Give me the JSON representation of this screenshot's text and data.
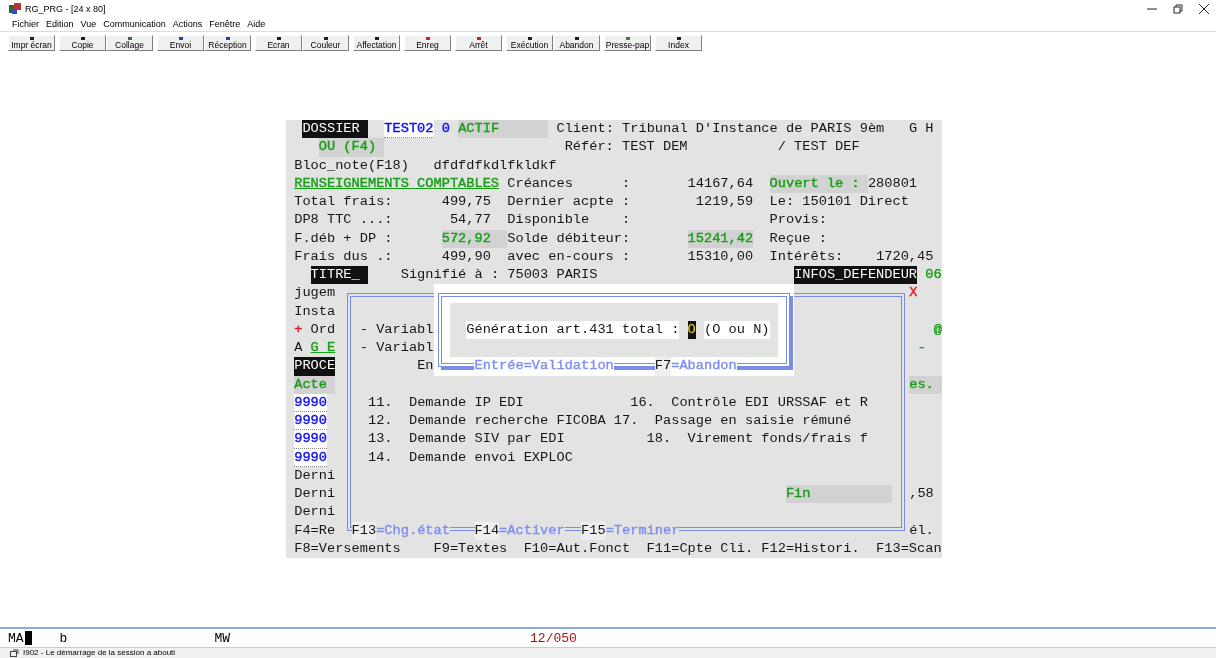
{
  "window": {
    "title": "RG_PRG - [24 x 80]"
  },
  "menu": [
    "Fichier",
    "Edition",
    "Vue",
    "Communication",
    "Actions",
    "Fenêtre",
    "Aide"
  ],
  "toolbar": [
    [
      {
        "label": "Impr écran",
        "color": "#202020"
      }
    ],
    [
      {
        "label": "Copie",
        "color": "#202020"
      },
      {
        "label": "Collage",
        "color": "#2a7a2a"
      }
    ],
    [
      {
        "label": "Envoi",
        "color": "#2040c0"
      },
      {
        "label": "Réception",
        "color": "#2040c0"
      }
    ],
    [
      {
        "label": "Ecran",
        "color": "#202020"
      },
      {
        "label": "Couleur",
        "color": "#202020"
      }
    ],
    [
      {
        "label": "Affectation",
        "color": "#202020"
      }
    ],
    [
      {
        "label": "Enreg",
        "color": "#d02020"
      }
    ],
    [
      {
        "label": "Arrêt",
        "color": "#d02020"
      }
    ],
    [
      {
        "label": "Exécution",
        "color": "#202020"
      },
      {
        "label": "Abandon",
        "color": "#202020"
      }
    ],
    [
      {
        "label": "Presse-pap",
        "color": "#2a8a2a"
      }
    ],
    [
      {
        "label": "Index",
        "color": "#202020"
      }
    ]
  ],
  "screen": {
    "lines": [
      {
        "segments": [
          {
            "text": " DOSSIER ",
            "kind": "inverse"
          },
          {
            "text": "  TEST02",
            "kind": "input",
            "color": "#1010f0"
          },
          {
            "text": " 0",
            "kind": "text",
            "color": "#1010f0"
          },
          {
            "text": " ACTIF      ",
            "kind": "field",
            "color": "#18a018"
          },
          {
            "text": " Client: Tribunal D'Instance de PARIS 9èm",
            "kind": "text"
          },
          {
            "text": "   G H",
            "kind": "text"
          }
        ]
      },
      {
        "segments": [
          {
            "text": "   OU (F4) ",
            "kind": "field",
            "color": "#18a018"
          },
          {
            "text": "                      Référ: TEST DEM",
            "kind": "text"
          },
          {
            "text": "           / TEST DEF",
            "kind": "text"
          }
        ]
      },
      {
        "segments": [
          {
            "text": "Bloc_note(F18)",
            "kind": "text"
          },
          {
            "text": "   dfdfdfkdlfkldkf",
            "kind": "text"
          }
        ]
      },
      {
        "segments": [
          {
            "text": "RENSEIGNEMENTS COMPTABLES",
            "kind": "text",
            "color": "#18a018",
            "underline": true
          },
          {
            "text": " Créances",
            "kind": "text"
          },
          {
            "text": "      :",
            "kind": "text"
          },
          {
            "text": "       14167,64",
            "kind": "text"
          },
          {
            "text": "  Ouvert le : ",
            "kind": "field",
            "color": "#18a018"
          },
          {
            "text": "280801",
            "kind": "text"
          }
        ]
      },
      {
        "segments": [
          {
            "text": "Total frais:",
            "kind": "text"
          },
          {
            "text": "      499,75",
            "kind": "text"
          },
          {
            "text": "  Dernier acpte :",
            "kind": "text"
          },
          {
            "text": "        1219,59",
            "kind": "text"
          },
          {
            "text": "  Le: 150101 Direct",
            "kind": "text"
          }
        ]
      },
      {
        "segments": [
          {
            "text": "DP8 TTC ...:",
            "kind": "text"
          },
          {
            "text": "       54,77",
            "kind": "text"
          },
          {
            "text": "  Disponible",
            "kind": "text"
          },
          {
            "text": "    :",
            "kind": "text"
          },
          {
            "text": "                 Provis:",
            "kind": "text"
          }
        ]
      },
      {
        "segments": [
          {
            "text": "F.déb + DP :",
            "kind": "text"
          },
          {
            "text": "      572,92  ",
            "kind": "field",
            "color": "#18a018"
          },
          {
            "text": "Solde débiteur:",
            "kind": "text"
          },
          {
            "text": "       15241,42",
            "kind": "field",
            "color": "#18a018"
          },
          {
            "text": "  Reçue :",
            "kind": "text"
          }
        ]
      },
      {
        "segments": [
          {
            "text": "Frais dus .:",
            "kind": "text"
          },
          {
            "text": "      499,90",
            "kind": "text"
          },
          {
            "text": "  avec en-cours :",
            "kind": "text"
          },
          {
            "text": "       15310,00",
            "kind": "text"
          },
          {
            "text": "  Intérêts:",
            "kind": "text"
          },
          {
            "text": "    1720,45",
            "kind": "text"
          }
        ]
      },
      {
        "segments": [
          {
            "text": "  TITRE_ ",
            "kind": "inverse"
          },
          {
            "text": "    Signifié à :",
            "kind": "text"
          },
          {
            "text": " 75003 PARIS",
            "kind": "text"
          },
          {
            "text": "                        INFOS_DEFENDEUR",
            "kind": "inverse"
          },
          {
            "text": " 06",
            "kind": "text",
            "color": "#18a018"
          }
        ]
      },
      {
        "segments": [
          {
            "text": "jugem",
            "kind": "text"
          }
        ],
        "right": [
          {
            "text": "X",
            "kind": "text",
            "color": "#e02020"
          }
        ]
      },
      {
        "segments": [
          {
            "text": "Insta",
            "kind": "text"
          }
        ]
      },
      {
        "segments": [
          {
            "text": "+",
            "kind": "text",
            "color": "#e02020"
          },
          {
            "text": " Ord",
            "kind": "text"
          }
        ],
        "right": [
          {
            "text": "   @",
            "kind": "text",
            "color": "#18a018"
          }
        ]
      },
      {
        "segments": [
          {
            "text": "A",
            "kind": "text"
          },
          {
            "text": " G E",
            "kind": "text",
            "color": "#18a018",
            "underline": true
          }
        ],
        "right": [
          {
            "text": " -",
            "kind": "text",
            "color": "#18a018"
          }
        ]
      },
      {
        "segments": [
          {
            "text": "PROCE",
            "kind": "inverse"
          }
        ]
      },
      {
        "segments": [
          {
            "text": "Acte ",
            "kind": "field",
            "color": "#18a018"
          }
        ],
        "right": [
          {
            "text": "es. ",
            "kind": "field",
            "color": "#18a018"
          }
        ]
      },
      {
        "segments": [
          {
            "text": "9990",
            "kind": "input",
            "color": "#1010f0"
          }
        ]
      },
      {
        "segments": [
          {
            "text": "9990",
            "kind": "input",
            "color": "#1010f0"
          }
        ]
      },
      {
        "segments": [
          {
            "text": "9990",
            "kind": "input",
            "color": "#1010f0"
          }
        ]
      },
      {
        "segments": [
          {
            "text": "9990",
            "kind": "input",
            "color": "#1010f0"
          }
        ]
      },
      {
        "segments": [
          {
            "text": "Derni",
            "kind": "text"
          }
        ]
      },
      {
        "segments": [
          {
            "text": "Derni",
            "kind": "text"
          }
        ],
        "right": [
          {
            "text": ",58",
            "kind": "text"
          }
        ]
      },
      {
        "segments": [
          {
            "text": "Derni",
            "kind": "text"
          }
        ]
      },
      {
        "segments": [
          {
            "text": "F4=Re",
            "kind": "text"
          }
        ],
        "right": [
          {
            "text": "él.",
            "kind": "text"
          }
        ]
      },
      {
        "segments": [
          {
            "text": "F8=Versements",
            "kind": "text"
          },
          {
            "text": "    F9=Textes",
            "kind": "text"
          },
          {
            "text": "  F10=Aut.Fonct",
            "kind": "text"
          },
          {
            "text": "  F11=Cpte Cli.",
            "kind": "text"
          },
          {
            "text": " F12=Histori.",
            "kind": "text"
          },
          {
            "text": "  F13=Scan",
            "kind": "text"
          }
        ]
      }
    ]
  },
  "dialogs": [
    {
      "lines": [
        {
          "kind": "blank"
        },
        {
          "kind": "blank"
        },
        {
          "kind": "text",
          "segments": [
            {
              "text": "  - Variabl",
              "kind": "text"
            }
          ]
        },
        {
          "kind": "text",
          "segments": [
            {
              "text": "  - Variabl",
              "kind": "text"
            }
          ]
        },
        {
          "kind": "text",
          "segments": [
            {
              "text": "         En",
              "kind": "text"
            }
          ]
        },
        {
          "kind": "blank"
        },
        {
          "kind": "text",
          "segments": [
            {
              "text": "   11.",
              "kind": "text"
            },
            {
              "text": "  Demande IP EDI",
              "kind": "text"
            },
            {
              "text": "             16.",
              "kind": "text"
            },
            {
              "text": "  Contrôle EDI URSSAF et R",
              "kind": "text"
            }
          ]
        },
        {
          "kind": "text",
          "segments": [
            {
              "text": "   12.",
              "kind": "text"
            },
            {
              "text": "  Demande recherche FICOBA",
              "kind": "text"
            },
            {
              "text": " 17.",
              "kind": "text"
            },
            {
              "text": "  Passage en saisie rémuné",
              "kind": "text"
            }
          ]
        },
        {
          "kind": "text",
          "segments": [
            {
              "text": "   13.",
              "kind": "text"
            },
            {
              "text": "  Demande SIV par EDI",
              "kind": "text"
            },
            {
              "text": "          18.",
              "kind": "text"
            },
            {
              "text": "  Virement fonds/frais f",
              "kind": "text"
            }
          ]
        },
        {
          "kind": "text",
          "segments": [
            {
              "text": "   14.",
              "kind": "text"
            },
            {
              "text": "  Demande envoi EXPLOC",
              "kind": "text"
            }
          ]
        },
        {
          "kind": "blank"
        },
        {
          "kind": "text",
          "segments": [
            {
              "text": "                                                      Fin          ",
              "kind": "field",
              "color": "#18a018"
            }
          ]
        },
        {
          "kind": "blank"
        },
        {
          "kind": "text",
          "segments": [
            {
              "text": " F13",
              "kind": "key"
            },
            {
              "text": "=Chg.état",
              "kind": "text",
              "color": "#7f8ff0"
            },
            {
              "text": "   F14",
              "kind": "key"
            },
            {
              "text": "=Activer",
              "kind": "text",
              "color": "#7f8ff0"
            },
            {
              "text": "  F15",
              "kind": "key"
            },
            {
              "text": "=Terminer",
              "kind": "text",
              "color": "#7f8ff0"
            }
          ]
        }
      ]
    },
    {
      "lines": [
        {
          "kind": "blank"
        },
        {
          "kind": "blank"
        },
        {
          "kind": "text",
          "segments": [
            {
              "text": "    Génération art.431 total :",
              "kind": "text"
            },
            {
              "text": " O",
              "kind": "cursor"
            },
            {
              "text": " (O ou N)",
              "kind": "text"
            }
          ]
        },
        {
          "kind": "blank"
        },
        {
          "kind": "text",
          "segments": [
            {
              "text": "     Entrée=Validation",
              "kind": "text",
              "color": "#7f8ff0"
            },
            {
              "text": "     F7",
              "kind": "key"
            },
            {
              "text": "=Abandon",
              "kind": "text",
              "color": "#7f8ff0"
            }
          ]
        }
      ]
    }
  ],
  "status_line": {
    "mode": "MA",
    "field_2": "b",
    "field_3": "MW",
    "position": "12/050"
  },
  "status_bar": {
    "message": "I902 - Le démarrage de la session a abouti"
  }
}
